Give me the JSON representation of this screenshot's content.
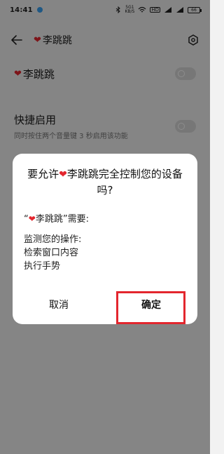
{
  "status_bar": {
    "time": "14:41",
    "net_top": "5G1",
    "net_bottom": "KB/S",
    "hd_label": "HD",
    "battery": "66"
  },
  "header": {
    "title": "李跳跳"
  },
  "settings": {
    "main_toggle_label": "李跳跳",
    "shortcut_title": "快捷启用",
    "shortcut_desc": "同时按住两个音量键 3 秒启用该功能"
  },
  "dialog": {
    "title_prefix": "要允许",
    "title_app": "李跳跳",
    "title_suffix": "完全控制您的设备吗?",
    "needs_open": "“",
    "needs_app": "李跳跳",
    "needs_close": "”需要:",
    "permissions": [
      "监测您的操作:",
      "检索窗口内容",
      "执行手势"
    ],
    "cancel_label": "取消",
    "confirm_label": "确定"
  },
  "colors": {
    "accent_red": "#e3262e",
    "highlight_red": "#e3262e",
    "status_dot": "#3aa0f0"
  }
}
